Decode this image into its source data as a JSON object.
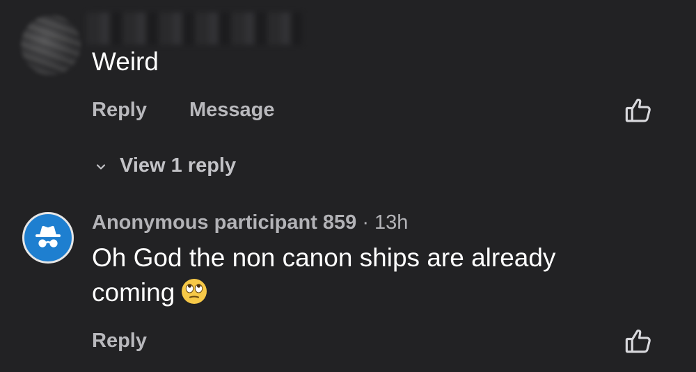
{
  "comments": [
    {
      "author": "",
      "text": "Weird",
      "actions": {
        "reply": "Reply",
        "message": "Message"
      },
      "replies_toggle": "View 1 reply"
    },
    {
      "author": "Anonymous participant 859",
      "separator": "·",
      "time": "13h",
      "text": "Oh God the non canon ships are already coming",
      "emoji": "face-with-rolling-eyes",
      "actions": {
        "reply": "Reply"
      }
    }
  ],
  "colors": {
    "background": "#222224",
    "avatar_blue": "#1e7fd0",
    "action_text": "#b9b9bd",
    "body_text": "#ffffff"
  }
}
